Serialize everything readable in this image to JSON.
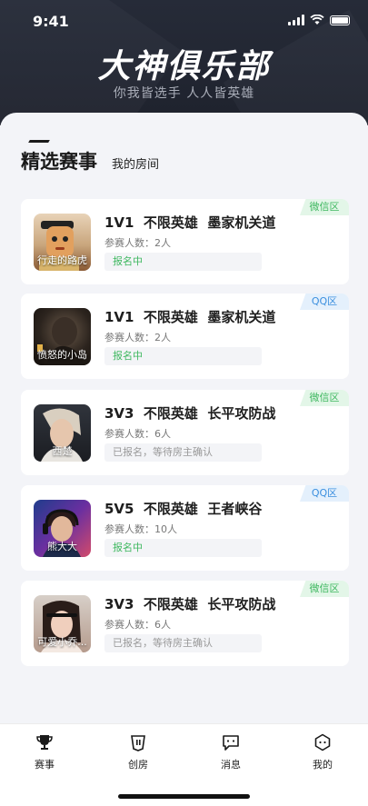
{
  "status_bar": {
    "time": "9:41"
  },
  "header": {
    "title": "大神俱乐部",
    "subtitle": "你我皆选手  人人皆英雄"
  },
  "tabs": {
    "active": "精选赛事",
    "inactive": "我的房间"
  },
  "cards": [
    {
      "title": "1V1  不限英雄  墨家机关道",
      "count": "参赛人数：2人",
      "status": "报名中",
      "badge": "微信区",
      "avatar_name": "行走的路虎"
    },
    {
      "title": "1V1  不限英雄  墨家机关道",
      "count": "参赛人数：2人",
      "status": "报名中",
      "badge": "QQ区",
      "avatar_name": "愤怒的小岛"
    },
    {
      "title": "3V3  不限英雄  长平攻防战",
      "count": "参赛人数：6人",
      "status": "已报名，等待房主确认",
      "badge": "微信区",
      "avatar_name": "西楚"
    },
    {
      "title": "5V5  不限英雄  王者峡谷",
      "count": "参赛人数：10人",
      "status": "报名中",
      "badge": "QQ区",
      "avatar_name": "熊大大"
    },
    {
      "title": "3V3  不限英雄  长平攻防战",
      "count": "参赛人数：6人",
      "status": "已报名，等待房主确认",
      "badge": "微信区",
      "avatar_name": "可爱小乔..."
    }
  ],
  "tabbar": {
    "events": "赛事",
    "create": "创房",
    "messages": "消息",
    "mine": "我的"
  },
  "colors": {
    "wechat_green": "#3fb860",
    "qq_blue": "#3b8fdf",
    "header_dark": "#262b38"
  }
}
